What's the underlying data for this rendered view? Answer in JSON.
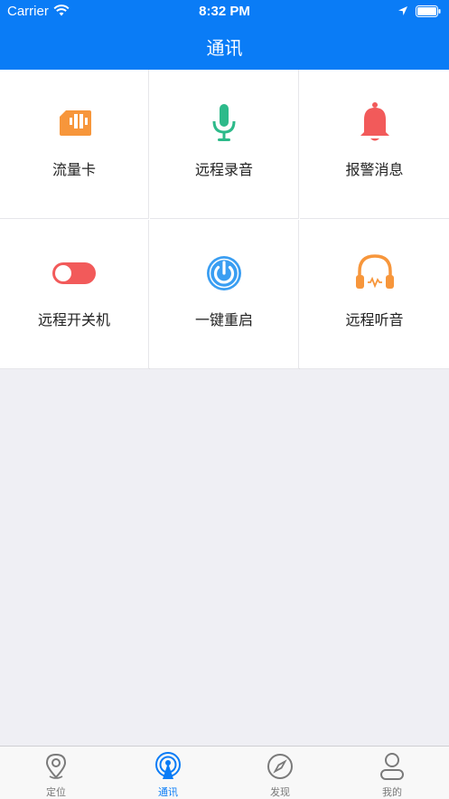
{
  "status_bar": {
    "carrier": "Carrier",
    "time": "8:32 PM"
  },
  "header": {
    "title": "通讯"
  },
  "grid": {
    "items": [
      {
        "label": "流量卡",
        "icon": "sim-card-icon",
        "color": "#f7963b"
      },
      {
        "label": "远程录音",
        "icon": "microphone-icon",
        "color": "#2dba8a"
      },
      {
        "label": "报警消息",
        "icon": "bell-icon",
        "color": "#f25a5a"
      },
      {
        "label": "远程开关机",
        "icon": "toggle-icon",
        "color": "#f25a5a"
      },
      {
        "label": "一键重启",
        "icon": "power-icon",
        "color": "#3a9ef2"
      },
      {
        "label": "远程听音",
        "icon": "headphones-icon",
        "color": "#f7963b"
      }
    ]
  },
  "tabbar": {
    "items": [
      {
        "label": "定位",
        "icon": "location-pin-icon",
        "active": false
      },
      {
        "label": "通讯",
        "icon": "broadcast-icon",
        "active": true
      },
      {
        "label": "发现",
        "icon": "compass-icon",
        "active": false
      },
      {
        "label": "我的",
        "icon": "user-icon",
        "active": false
      }
    ],
    "active_color": "#0a7cf6",
    "inactive_color": "#7a7a7a"
  }
}
